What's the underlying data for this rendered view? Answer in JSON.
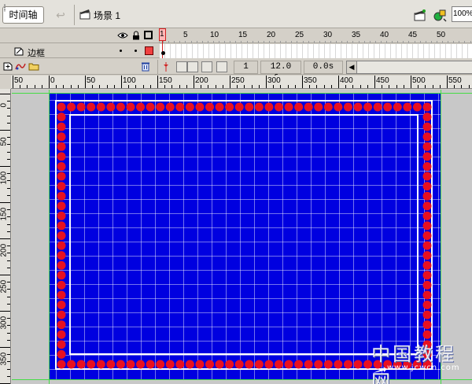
{
  "header": {
    "timeline_tab": "时间轴",
    "scene_label": "场景 1",
    "zoom_value": "100%"
  },
  "timeline": {
    "frame_numbers": [
      "1",
      "5",
      "10",
      "15",
      "20",
      "25",
      "30",
      "35",
      "40",
      "45",
      "50"
    ],
    "current_frame_marker": "1",
    "layers": [
      {
        "name": "边框",
        "color": "#f04040"
      }
    ],
    "current_frame": "1",
    "frame_rate": "12.0 fps",
    "elapsed_time": "0.0s"
  },
  "rulers": {
    "horizontal": [
      "50",
      "0",
      "50",
      "100",
      "150",
      "200",
      "250",
      "300",
      "350",
      "400",
      "450",
      "500",
      "550"
    ],
    "vertical": [
      "0",
      "50",
      "100",
      "150",
      "200",
      "250",
      "300",
      "350"
    ]
  },
  "stage": {
    "background_color": "#0000e0",
    "dot_color": "#e81020",
    "border_color": "#ffffff"
  },
  "watermark": {
    "title": "中国教程网",
    "url": "www.jcwcn.com"
  }
}
